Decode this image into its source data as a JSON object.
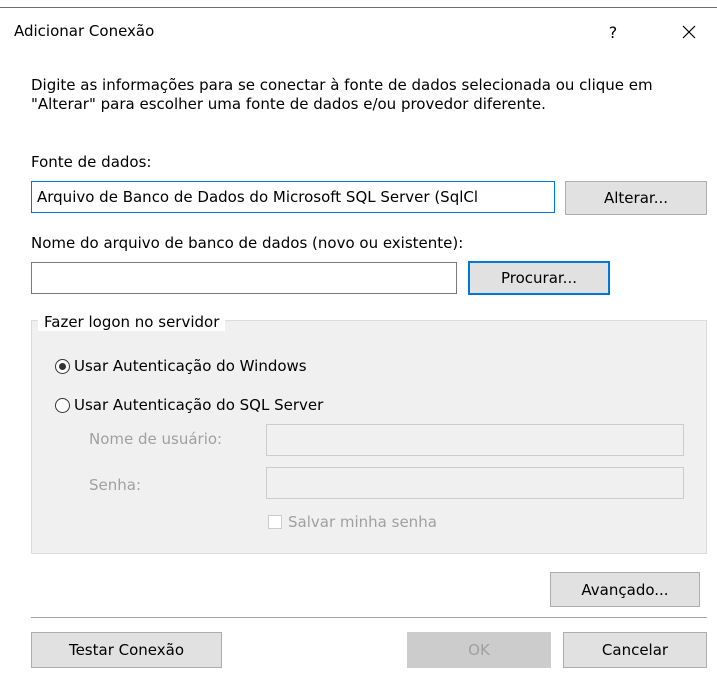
{
  "window": {
    "title": "Adicionar Conexão",
    "help_label": "?",
    "close_icon": "close-icon"
  },
  "instructions": "Digite as informações para se conectar à fonte de dados selecionada ou clique em \"Alterar\" para escolher uma fonte de dados e/ou provedor diferente.",
  "data_source": {
    "label": "Fonte de dados:",
    "value": "Arquivo de Banco de Dados do Microsoft SQL Server (SqlCl",
    "change_button": "Alterar..."
  },
  "database_file": {
    "label": "Nome do arquivo de banco de dados (novo ou existente):",
    "value": "",
    "browse_button": "Procurar..."
  },
  "logon": {
    "group_label": "Fazer logon no servidor",
    "windows_auth": {
      "label": "Usar Autenticação do Windows",
      "checked": true
    },
    "sql_auth": {
      "label": "Usar Autenticação do SQL Server",
      "checked": false
    },
    "username_label": "Nome de usuário:",
    "username_value": "",
    "password_label": "Senha:",
    "password_value": "",
    "save_password": {
      "label": "Salvar minha senha",
      "checked": false
    }
  },
  "buttons": {
    "advanced": "Avançado...",
    "test": "Testar Conexão",
    "ok": "OK",
    "cancel": "Cancelar"
  },
  "colors": {
    "accent": "#0078d7",
    "button_face": "#e1e1e1",
    "group_background": "#f0f0f0",
    "disabled_text": "#a0a0a0"
  }
}
